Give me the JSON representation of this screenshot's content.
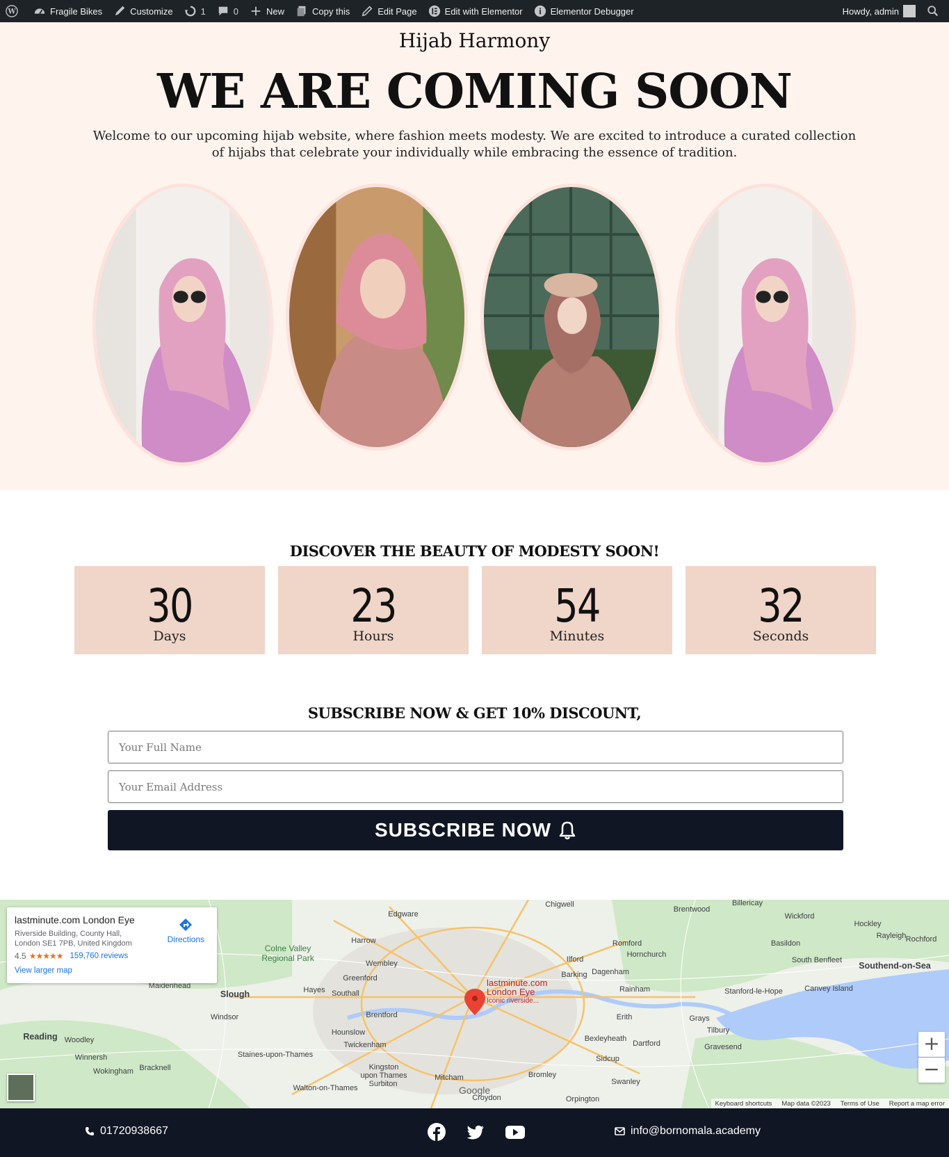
{
  "admin_bar": {
    "site_name": "Fragile Bikes",
    "customize": "Customize",
    "updates_count": "1",
    "comments_count": "0",
    "new": "New",
    "copy_this": "Copy this",
    "edit_page": "Edit Page",
    "edit_with_elementor": "Edit with Elementor",
    "elementor_debugger": "Elementor Debugger",
    "greeting": "Howdy, admin"
  },
  "hero": {
    "site_title": "Hijab Harmony",
    "headline": "WE ARE COMING SOON",
    "intro": "Welcome to our upcoming hijab website, where fashion meets modesty. We are excited to introduce a curated collection of hijabs that celebrate your individually while embracing the essence of tradition."
  },
  "countdown": {
    "title": "DISCOVER THE BEAUTY OF MODESTY SOON!",
    "units": [
      {
        "value": "30",
        "label": "Days"
      },
      {
        "value": "23",
        "label": "Hours"
      },
      {
        "value": "54",
        "label": "Minutes"
      },
      {
        "value": "32",
        "label": "Seconds"
      }
    ]
  },
  "subscribe": {
    "title": "SUBSCRIBE NOW & GET 10% DISCOUNT,",
    "name_placeholder": "Your Full Name",
    "email_placeholder": "Your Email Address",
    "button_label": "SUBSCRIBE NOW"
  },
  "map": {
    "place_name": "lastminute.com London Eye",
    "address": "Riverside Building, County Hall, London SE1 7PB, United Kingdom",
    "rating": "4.5",
    "stars": "★★★★★",
    "reviews": "159,760 reviews",
    "directions": "Directions",
    "view_larger": "View larger map",
    "pin_label_1": "lastminute.com",
    "pin_label_2": "London Eye",
    "pin_label_3": "Iconic riverside...",
    "google": "Google",
    "attribution": [
      "Keyboard shortcuts",
      "Map data ©2023",
      "Terms of Use",
      "Report a map error"
    ],
    "towns": [
      "Chigwell",
      "Brentwood",
      "Billericay",
      "Wickford",
      "Hockley",
      "Rayleigh",
      "Rochford",
      "Basildon",
      "South Benfleet",
      "Southend-on-Sea",
      "Canvey Island",
      "Stanford-le-Hope",
      "Grays",
      "Tilbury",
      "Gravesend",
      "Dartford",
      "Bexleyheath",
      "Erith",
      "Sidcup",
      "Swanley",
      "Bromley",
      "Romford",
      "Hornchurch",
      "Ilford",
      "Barking",
      "Dagenham",
      "Rainham",
      "Edgware",
      "Harrow",
      "Wembley",
      "Greenford",
      "Hayes",
      "Southall",
      "Brentford",
      "Hounslow",
      "Twickenham",
      "Kingston upon Thames",
      "Surbiton",
      "Walton-on-Thames",
      "Staines-upon-Thames",
      "Windsor",
      "Slough",
      "Colne Valley Regional Park",
      "Maidenhead",
      "Reading",
      "Woodley",
      "Winnersh",
      "Wokingham",
      "Bracknell",
      "Mitcham",
      "Croydon",
      "Orpington"
    ]
  },
  "footer": {
    "phone": "01720938667",
    "email": "info@bornomala.academy",
    "social": [
      "facebook-icon",
      "twitter-icon",
      "youtube-icon"
    ]
  },
  "colors": {
    "hero_bg": "#fff3ee",
    "count_box": "#f0d5c9",
    "button_bg": "#111624",
    "oval_border": "#fde2db"
  }
}
